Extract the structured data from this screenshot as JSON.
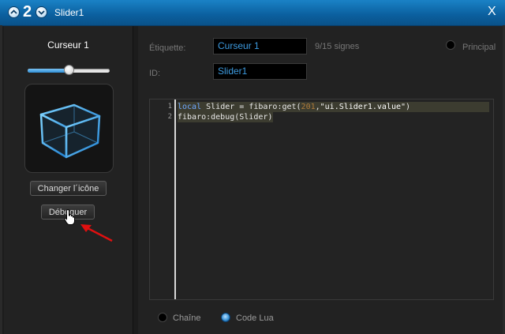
{
  "titlebar": {
    "number": "2",
    "title": "Slider1",
    "close_label": "X",
    "up_icon": "chevron-up-icon",
    "down_icon": "chevron-down-icon"
  },
  "left": {
    "title": "Curseur 1",
    "slider_value_fraction": 0.5,
    "icon": "cube-icon",
    "change_icon_label": "Changer l´icône",
    "debug_label": "Déboguer"
  },
  "right": {
    "label_etiquette": "Étiquette:",
    "etiquette_value": "Curseur 1",
    "char_count": "9/15 signes",
    "principal_label": "Principal",
    "label_id": "ID:",
    "id_value": "Slider1",
    "radio_chaine": "Chaîne",
    "radio_lua": "Code Lua"
  },
  "code": {
    "line_numbers": [
      "1",
      "2"
    ],
    "line1": {
      "kw": "local",
      "a": " Slider = fibaro:get(",
      "num": "201",
      "b": ",",
      "str": "\"ui.Slider1.value\"",
      "c": ")"
    },
    "line2": "fibaro:debug(Slider)"
  },
  "colors": {
    "accent": "#1a82c6",
    "field_text": "#3d9be0"
  }
}
